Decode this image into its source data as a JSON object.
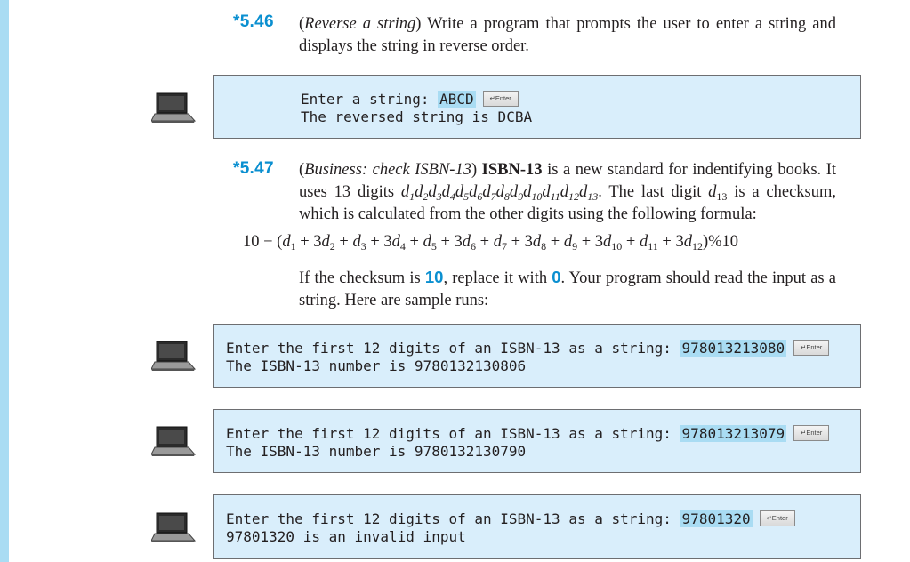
{
  "ex46": {
    "number": "*5.46",
    "title": "Reverse a string",
    "text": " Write a program that prompts the user to enter a string and displays the string in reverse order."
  },
  "console1": {
    "prompt": "Enter a string: ",
    "input": "ABCD",
    "output": "The reversed string is DCBA"
  },
  "ex47": {
    "number": "*5.47",
    "title": "Business: check ISBN-13",
    "bold_term": "ISBN-13",
    "text_a": " is a new standard for indentifying books. It uses 13 digits ",
    "text_b": ". The last digit ",
    "text_c": " is a checksum, which is calculated from the other digits using the following formula:",
    "formula_prefix": "10 − (",
    "formula_suffix": ")%10",
    "after_a": "If the checksum is ",
    "ten": "10",
    "after_b": ", replace it with ",
    "zero": "0",
    "after_c": ". Your program should read the input as a string. Here are sample runs:"
  },
  "enter_key_label": "↵Enter",
  "console2": {
    "prompt": "Enter the first 12 digits of an ISBN-13 as a string: ",
    "input": "978013213080",
    "output": "The ISBN-13 number is 9780132130806"
  },
  "console3": {
    "prompt": "Enter the first 12 digits of an ISBN-13 as a string: ",
    "input": "978013213079",
    "output": "The ISBN-13 number is 9780132130790"
  },
  "console4": {
    "prompt": "Enter the first 12 digits of an ISBN-13 as a string: ",
    "input": "97801320",
    "output": "97801320 is an invalid input"
  },
  "colors": {
    "accent": "#0a8fd0",
    "console_bg": "#d9eefb",
    "input_highlight": "#a9dcf3"
  },
  "icons": [
    "laptop-icon"
  ]
}
